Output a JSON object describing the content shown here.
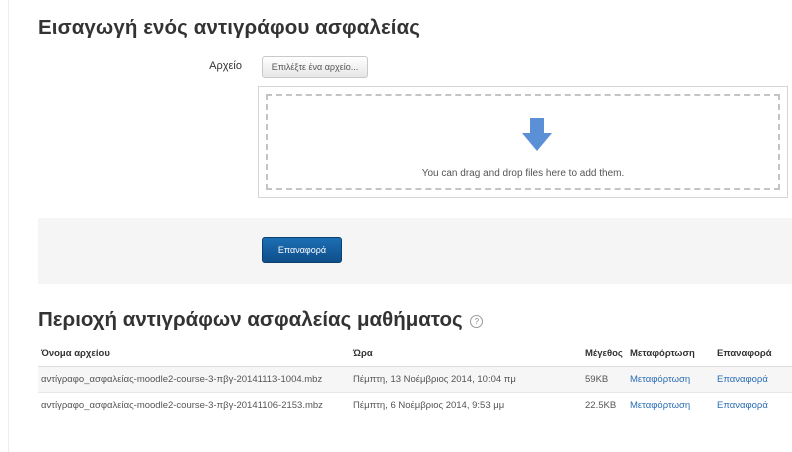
{
  "restore": {
    "heading": "Εισαγωγή ενός αντιγράφου ασφαλείας",
    "file_label": "Αρχείο",
    "choose_button": "Επιλέξτε ένα αρχείο...",
    "drop_text": "You can drag and drop files here to add them.",
    "restore_button": "Επαναφορά",
    "icon": "down-arrow-icon"
  },
  "backup_area": {
    "heading": "Περιοχή αντιγράφων ασφαλείας μαθήματος",
    "help_icon": "?",
    "columns": [
      "Όνομα αρχείου",
      "Ώρα",
      "Μέγεθος",
      "Μεταφόρτωση",
      "Επαναφορά"
    ],
    "rows": [
      {
        "name": "αντίγραφο_ασφαλείας-moodle2-course-3-πβγ-20141113-1004.mbz",
        "time": "Πέμπτη, 13 Νοέμβριος 2014, 10:04 πμ",
        "size": "59KB",
        "download": "Μεταφόρτωση",
        "restore": "Επαναφορά"
      },
      {
        "name": "αντίγραφο_ασφαλείας-moodle2-course-3-πβγ-20141106-2153.mbz",
        "time": "Πέμπτη, 6 Νοέμβριος 2014, 9:53 μμ",
        "size": "22.5KB",
        "download": "Μεταφόρτωση",
        "restore": "Επαναφορά"
      }
    ]
  },
  "colors": {
    "primary_button": "#1a66ab",
    "link": "#2a6db3",
    "band": "#f5f5f5",
    "arrow": "#5b8fd6"
  }
}
